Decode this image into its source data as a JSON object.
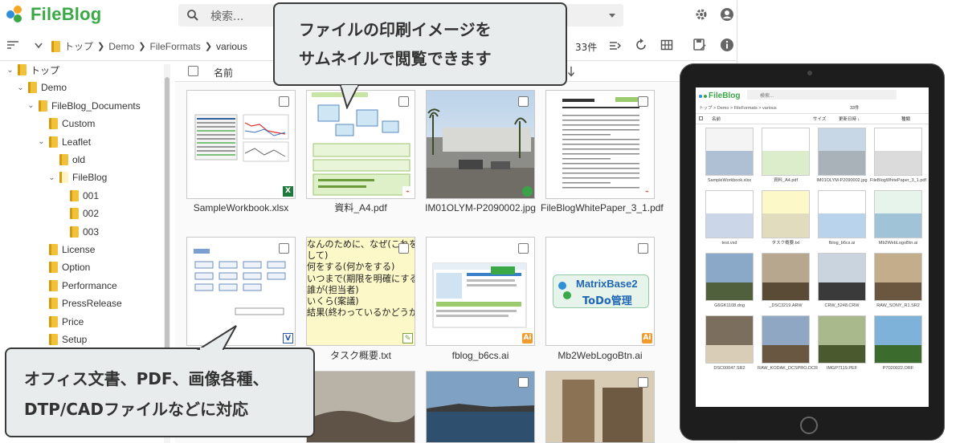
{
  "app": {
    "name": "FileBlog"
  },
  "search": {
    "placeholder": "検索..."
  },
  "breadcrumb": {
    "items": [
      "トップ",
      "Demo",
      "FileFormats",
      "various"
    ]
  },
  "item_count": "33件",
  "grid_header": {
    "name_col": "名前"
  },
  "tree": {
    "items": [
      {
        "label": "トップ",
        "depth": 0,
        "expanded": true
      },
      {
        "label": "Demo",
        "depth": 1,
        "expanded": true
      },
      {
        "label": "FileBlog_Documents",
        "depth": 2,
        "expanded": true
      },
      {
        "label": "Custom",
        "depth": 3,
        "expanded": false
      },
      {
        "label": "Leaflet",
        "depth": 3,
        "expanded": true
      },
      {
        "label": "old",
        "depth": 4,
        "expanded": false
      },
      {
        "label": "FileBlog",
        "depth": 4,
        "expanded": true
      },
      {
        "label": "001",
        "depth": 5,
        "expanded": false
      },
      {
        "label": "002",
        "depth": 5,
        "expanded": false
      },
      {
        "label": "003",
        "depth": 5,
        "expanded": false
      },
      {
        "label": "License",
        "depth": 3,
        "expanded": false
      },
      {
        "label": "Option",
        "depth": 3,
        "expanded": false
      },
      {
        "label": "Performance",
        "depth": 3,
        "expanded": false
      },
      {
        "label": "PressRelease",
        "depth": 3,
        "expanded": false
      },
      {
        "label": "Price",
        "depth": 3,
        "expanded": false
      },
      {
        "label": "Setup",
        "depth": 3,
        "expanded": false
      }
    ]
  },
  "files": [
    {
      "name": "SampleWorkbook.xlsx",
      "badge": "X",
      "badge_color": "#1d7a3c",
      "kind": "sheet"
    },
    {
      "name": "資料_A4.pdf",
      "badge": "PDF",
      "badge_color": "#d9342b",
      "kind": "flyer"
    },
    {
      "name": "IM01OLYM-P2090002.jpg",
      "badge": "img",
      "badge_color": "#3aa34a",
      "kind": "photo-building"
    },
    {
      "name": "FileBlogWhitePaper_3_1.pdf",
      "badge": "PDF",
      "badge_color": "#d9342b",
      "kind": "doc"
    },
    {
      "name": "",
      "badge": "V",
      "badge_color": "#2d5aa8",
      "kind": "diagram"
    },
    {
      "name": "タスク概要.txt",
      "badge": "txt",
      "badge_color": "#7aa03c",
      "kind": "text"
    },
    {
      "name": "fblog_b6cs.ai",
      "badge": "Ai",
      "badge_color": "#f29a2e",
      "kind": "web"
    },
    {
      "name": "Mb2WebLogoBtn.ai",
      "badge": "Ai",
      "badge_color": "#f29a2e",
      "kind": "logo"
    }
  ],
  "text_preview": {
    "lines": [
      "なんのために、なぜ(これを目指",
      "して)",
      "何をする(何かをする)",
      "いつまで(期限を明確にする)",
      "誰が(担当者)",
      "いくら(案議)",
      "結果(終わっているかどうか)"
    ]
  },
  "logo_preview": {
    "line1": "MatrixBase2",
    "line2": "ToDo管理"
  },
  "callouts": {
    "top": [
      "ファイルの印刷イメージを",
      "サムネイルで閲覧できます"
    ],
    "bottom": [
      "オフィス文書、PDF、画像各種、",
      "DTP/CADファイルなどに対応"
    ]
  },
  "tablet": {
    "app_name": "FileBlog",
    "search_placeholder": "検索...",
    "breadcrumb": "トップ > Demo > FileFormats > various",
    "count": "33件",
    "col_name": "名前",
    "col_size": "サイズ",
    "col_date": "更新日時 ↓",
    "col_type": "種類",
    "files": [
      "SampleWorkbook.xlsx",
      "資料_A4.pdf",
      "IM01OLYM-P2090002.jpg",
      "FileBlogWhitePaper_3_1.pdf",
      "test.vsd",
      "タスク概要.txt",
      "fblog_b6cs.ai",
      "Mb2WebLogoBtn.ai",
      "G6GK1108.dng",
      "_DSC3219.ARW",
      "CRW_5248.CRW",
      "RAW_SONY_R1.SR2",
      "DSC00047.SR2",
      "RAW_KODAK_DCSPRO.DCR",
      "IMGP7119.PEF",
      "P7020022.ORF"
    ]
  },
  "colors": {
    "brand_green": "#39a845",
    "folder": "#f2c13a",
    "callout_bg": "#e9ecec"
  }
}
